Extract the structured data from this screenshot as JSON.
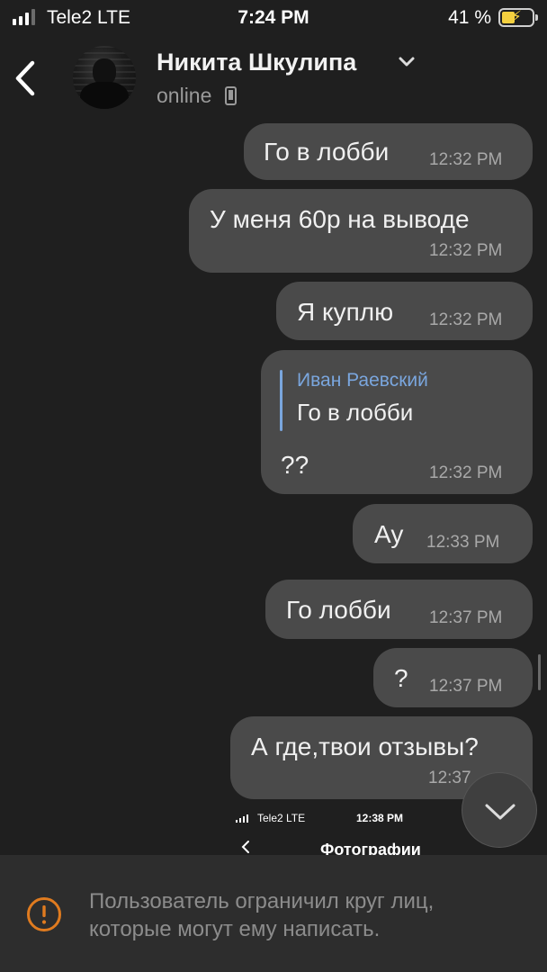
{
  "status_bar": {
    "carrier": "Tele2  LTE",
    "time": "7:24 PM",
    "battery_percent": "41 %",
    "battery_level": 0.41,
    "icons": [
      "signal-icon",
      "battery-charging-icon"
    ]
  },
  "header": {
    "contact_name": "Никита Шкулипа",
    "status": "online",
    "icons": [
      "back-chevron-icon",
      "chevron-down-icon",
      "phone-device-icon"
    ]
  },
  "messages": [
    {
      "text": "Го в лобби",
      "time": "12:32 PM"
    },
    {
      "text": "У меня 60р на выводе",
      "time": "12:32 PM"
    },
    {
      "text": "Я куплю",
      "time": "12:32 PM"
    },
    {
      "reply_author": "Иван Раевский",
      "reply_text": "Го в лобби",
      "text": "??",
      "time": "12:32 PM"
    },
    {
      "text": "Ау",
      "time": "12:33 PM"
    },
    {
      "text": "Го лобби",
      "time": "12:37 PM"
    },
    {
      "text": "?",
      "time": "12:37 PM"
    },
    {
      "text": "А где,твои отзывы?",
      "time": "12:37"
    }
  ],
  "embedded_screenshot": {
    "carrier": "Tele2  LTE",
    "time": "12:38 PM",
    "title": "Фотографии"
  },
  "scroll_button": {
    "icon": "chevron-down-icon"
  },
  "restriction_notice": {
    "icon": "warning-icon",
    "text": "Пользователь ограничил круг лиц, которые могут ему написать."
  },
  "colors": {
    "background": "#1f1f1f",
    "bubble": "#4a4a4a",
    "reply_accent": "#7aa6de",
    "warning": "#e07b1f",
    "battery": "#f4d03f"
  }
}
